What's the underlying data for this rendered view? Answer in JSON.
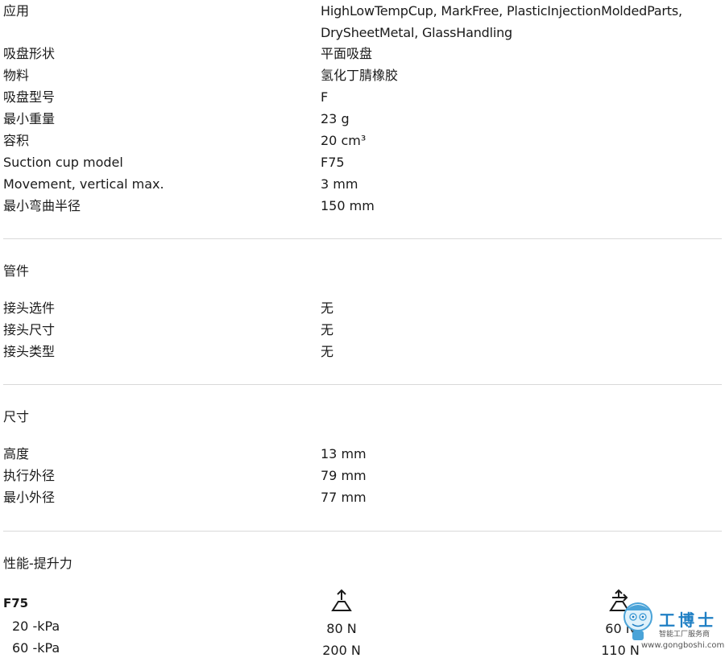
{
  "specs": [
    {
      "label": "应用",
      "value": "HighLowTempCup, MarkFree, PlasticInjectionMoldedParts, DrySheetMetal, GlassHandling"
    },
    {
      "label": "吸盘形状",
      "value": "平面吸盘"
    },
    {
      "label": "物料",
      "value": "氢化丁腈橡胶"
    },
    {
      "label": "吸盘型号",
      "value": "F"
    },
    {
      "label": "最小重量",
      "value": "23 g"
    },
    {
      "label": "容积",
      "value": "20 cm³"
    },
    {
      "label": "Suction cup model",
      "value": "F75"
    },
    {
      "label": "Movement, vertical max.",
      "value": "3 mm"
    },
    {
      "label": "最小弯曲半径",
      "value": "150 mm"
    }
  ],
  "fitting": {
    "title": "管件",
    "rows": [
      {
        "label": "接头选件",
        "value": "无"
      },
      {
        "label": "接头尺寸",
        "value": "无"
      },
      {
        "label": "接头类型",
        "value": "无"
      }
    ]
  },
  "dimensions": {
    "title": "尺寸",
    "rows": [
      {
        "label": "高度",
        "value": "13 mm"
      },
      {
        "label": "执行外径",
        "value": "79 mm"
      },
      {
        "label": "最小外径",
        "value": "77 mm"
      }
    ]
  },
  "performance": {
    "title": "性能-提升力",
    "model": "F75",
    "rows": [
      {
        "label": "20 -kPa",
        "vertical": "80 N",
        "lateral": "60 N"
      },
      {
        "label": "60 -kPa",
        "vertical": "200 N",
        "lateral": "110 N"
      }
    ],
    "icons": [
      "vertical-lift-icon",
      "lateral-lift-icon"
    ]
  },
  "watermark": {
    "brand_cn": "工博士",
    "tagline": "智能工厂服务商",
    "url": "www.gongboshi.com",
    "color": "#1f7fc4"
  }
}
